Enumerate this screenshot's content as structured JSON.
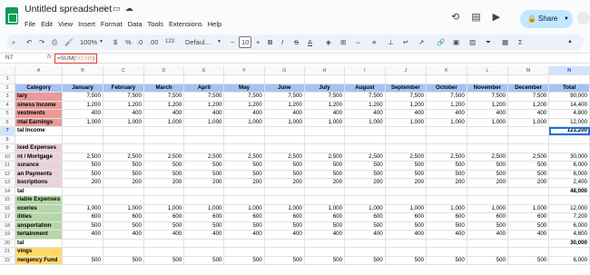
{
  "app": {
    "doc_title": "Untitled spreadsheet",
    "menu": [
      "File",
      "Edit",
      "View",
      "Insert",
      "Format",
      "Data",
      "Tools",
      "Extensions",
      "Help"
    ],
    "share_label": "Share"
  },
  "toolbar": {
    "zoom": "100%",
    "currency": "$",
    "percent": "%",
    "dec_less": ".0",
    "dec_more": ".00",
    "number_format": "123",
    "font": "Defaul...",
    "font_size": "10",
    "bold": "B",
    "italic": "I",
    "strike": "S",
    "text_color": "A"
  },
  "formula_bar": {
    "cell_ref": "N7",
    "fx": "fx",
    "formula_prefix": "=SUM(",
    "formula_range": "N3:N6",
    "formula_suffix": ")"
  },
  "grid": {
    "columns": [
      "A",
      "B",
      "C",
      "D",
      "E",
      "F",
      "G",
      "H",
      "I",
      "J",
      "K",
      "L",
      "M",
      "N"
    ],
    "selected_column": "N",
    "selected_row": "7",
    "rows": [
      {
        "n": "2",
        "cells": [
          "Category",
          "January",
          "February",
          "March",
          "April",
          "May",
          "June",
          "July",
          "August",
          "September",
          "October",
          "November",
          "December",
          "Total"
        ],
        "kind": "header"
      },
      {
        "n": "3",
        "cells": [
          "lary",
          "7,500",
          "7,500",
          "7,500",
          "7,500",
          "7,500",
          "7,500",
          "7,500",
          "7,500",
          "7,500",
          "7,500",
          "7,500",
          "7,500",
          "90,000"
        ],
        "a": "red"
      },
      {
        "n": "4",
        "cells": [
          "siness Income",
          "1,200",
          "1,200",
          "1,200",
          "1,200",
          "1,200",
          "1,200",
          "1,200",
          "1,200",
          "1,200",
          "1,200",
          "1,200",
          "1,200",
          "14,400"
        ],
        "a": "red"
      },
      {
        "n": "5",
        "cells": [
          "vestments",
          "400",
          "400",
          "400",
          "400",
          "400",
          "400",
          "400",
          "400",
          "400",
          "400",
          "400",
          "400",
          "4,800"
        ],
        "a": "red"
      },
      {
        "n": "6",
        "cells": [
          "ntal Earnings",
          "1,000",
          "1,000",
          "1,000",
          "1,000",
          "1,000",
          "1,000",
          "1,000",
          "1,000",
          "1,000",
          "1,000",
          "1,000",
          "1,000",
          "12,000"
        ],
        "a": "red"
      },
      {
        "n": "7",
        "cells": [
          "tal Income",
          "",
          "",
          "",
          "",
          "",
          "",
          "",
          "",
          "",
          "",
          "",
          "",
          "121,200"
        ],
        "bold": true
      },
      {
        "n": "8",
        "cells": [
          "",
          "",
          "",
          "",
          "",
          "",
          "",
          "",
          "",
          "",
          "",
          "",
          "",
          ""
        ]
      },
      {
        "n": "9",
        "cells": [
          "ixed Expenses",
          "",
          "",
          "",
          "",
          "",
          "",
          "",
          "",
          "",
          "",
          "",
          "",
          ""
        ],
        "a": "pink",
        "bold": true
      },
      {
        "n": "10",
        "cells": [
          "nt / Mortgage",
          "2,500",
          "2,500",
          "2,500",
          "2,500",
          "2,500",
          "2,500",
          "2,500",
          "2,500",
          "2,500",
          "2,500",
          "2,500",
          "2,500",
          "30,000"
        ],
        "a": "pink"
      },
      {
        "n": "11",
        "cells": [
          "surance",
          "500",
          "500",
          "500",
          "500",
          "500",
          "500",
          "500",
          "500",
          "500",
          "500",
          "500",
          "500",
          "6,000"
        ],
        "a": "pink"
      },
      {
        "n": "12",
        "cells": [
          "an Payments",
          "500",
          "500",
          "500",
          "500",
          "500",
          "500",
          "500",
          "500",
          "500",
          "500",
          "500",
          "500",
          "6,000"
        ],
        "a": "pink"
      },
      {
        "n": "13",
        "cells": [
          "bscriptions",
          "200",
          "200",
          "200",
          "200",
          "200",
          "200",
          "200",
          "200",
          "200",
          "200",
          "200",
          "200",
          "2,400"
        ],
        "a": "pink"
      },
      {
        "n": "14",
        "cells": [
          "tal",
          "",
          "",
          "",
          "",
          "",
          "",
          "",
          "",
          "",
          "",
          "",
          "",
          "48,000"
        ],
        "bold": true
      },
      {
        "n": "15",
        "cells": [
          "riable Expenses",
          "",
          "",
          "",
          "",
          "",
          "",
          "",
          "",
          "",
          "",
          "",
          "",
          ""
        ],
        "a": "green",
        "bold": true
      },
      {
        "n": "16",
        "cells": [
          "oceries",
          "1,000",
          "1,000",
          "1,000",
          "1,000",
          "1,000",
          "1,000",
          "1,000",
          "1,000",
          "1,000",
          "1,000",
          "1,000",
          "1,000",
          "12,000"
        ],
        "a": "green"
      },
      {
        "n": "17",
        "cells": [
          "ilities",
          "600",
          "600",
          "600",
          "600",
          "600",
          "600",
          "600",
          "600",
          "600",
          "600",
          "600",
          "600",
          "7,200"
        ],
        "a": "green"
      },
      {
        "n": "18",
        "cells": [
          "ansportation",
          "500",
          "500",
          "500",
          "500",
          "500",
          "500",
          "500",
          "500",
          "500",
          "500",
          "500",
          "500",
          "6,000"
        ],
        "a": "green"
      },
      {
        "n": "19",
        "cells": [
          "tertainment",
          "400",
          "400",
          "400",
          "400",
          "400",
          "400",
          "400",
          "400",
          "400",
          "400",
          "400",
          "400",
          "4,800"
        ],
        "a": "green"
      },
      {
        "n": "20",
        "cells": [
          "tal",
          "",
          "",
          "",
          "",
          "",
          "",
          "",
          "",
          "",
          "",
          "",
          "",
          "30,000"
        ],
        "bold": true
      },
      {
        "n": "21",
        "cells": [
          "vings",
          "",
          "",
          "",
          "",
          "",
          "",
          "",
          "",
          "",
          "",
          "",
          "",
          ""
        ],
        "a": "yellow",
        "bold": true
      },
      {
        "n": "22",
        "cells": [
          "nergency Fund",
          "500",
          "500",
          "500",
          "500",
          "500",
          "500",
          "500",
          "500",
          "500",
          "500",
          "500",
          "500",
          "6,000"
        ],
        "a": "yellow"
      }
    ]
  },
  "colors": {
    "header_blue": "#a4c2f4",
    "income_red": "#ea9999",
    "fixed_pink": "#ead1dc",
    "variable_green": "#b6d7a8",
    "savings_yellow": "#ffd966",
    "selection_blue": "#1a73e8",
    "share_bg": "#c2e7ff"
  }
}
